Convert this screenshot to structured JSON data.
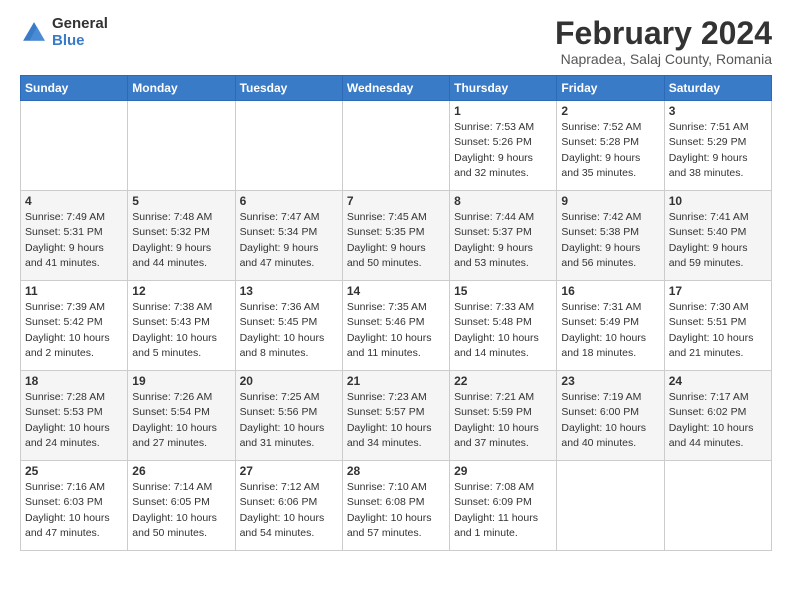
{
  "logo": {
    "general": "General",
    "blue": "Blue"
  },
  "header": {
    "title": "February 2024",
    "subtitle": "Napradea, Salaj County, Romania"
  },
  "weekdays": [
    "Sunday",
    "Monday",
    "Tuesday",
    "Wednesday",
    "Thursday",
    "Friday",
    "Saturday"
  ],
  "weeks": [
    [
      {
        "day": "",
        "info": ""
      },
      {
        "day": "",
        "info": ""
      },
      {
        "day": "",
        "info": ""
      },
      {
        "day": "",
        "info": ""
      },
      {
        "day": "1",
        "info": "Sunrise: 7:53 AM\nSunset: 5:26 PM\nDaylight: 9 hours\nand 32 minutes."
      },
      {
        "day": "2",
        "info": "Sunrise: 7:52 AM\nSunset: 5:28 PM\nDaylight: 9 hours\nand 35 minutes."
      },
      {
        "day": "3",
        "info": "Sunrise: 7:51 AM\nSunset: 5:29 PM\nDaylight: 9 hours\nand 38 minutes."
      }
    ],
    [
      {
        "day": "4",
        "info": "Sunrise: 7:49 AM\nSunset: 5:31 PM\nDaylight: 9 hours\nand 41 minutes."
      },
      {
        "day": "5",
        "info": "Sunrise: 7:48 AM\nSunset: 5:32 PM\nDaylight: 9 hours\nand 44 minutes."
      },
      {
        "day": "6",
        "info": "Sunrise: 7:47 AM\nSunset: 5:34 PM\nDaylight: 9 hours\nand 47 minutes."
      },
      {
        "day": "7",
        "info": "Sunrise: 7:45 AM\nSunset: 5:35 PM\nDaylight: 9 hours\nand 50 minutes."
      },
      {
        "day": "8",
        "info": "Sunrise: 7:44 AM\nSunset: 5:37 PM\nDaylight: 9 hours\nand 53 minutes."
      },
      {
        "day": "9",
        "info": "Sunrise: 7:42 AM\nSunset: 5:38 PM\nDaylight: 9 hours\nand 56 minutes."
      },
      {
        "day": "10",
        "info": "Sunrise: 7:41 AM\nSunset: 5:40 PM\nDaylight: 9 hours\nand 59 minutes."
      }
    ],
    [
      {
        "day": "11",
        "info": "Sunrise: 7:39 AM\nSunset: 5:42 PM\nDaylight: 10 hours\nand 2 minutes."
      },
      {
        "day": "12",
        "info": "Sunrise: 7:38 AM\nSunset: 5:43 PM\nDaylight: 10 hours\nand 5 minutes."
      },
      {
        "day": "13",
        "info": "Sunrise: 7:36 AM\nSunset: 5:45 PM\nDaylight: 10 hours\nand 8 minutes."
      },
      {
        "day": "14",
        "info": "Sunrise: 7:35 AM\nSunset: 5:46 PM\nDaylight: 10 hours\nand 11 minutes."
      },
      {
        "day": "15",
        "info": "Sunrise: 7:33 AM\nSunset: 5:48 PM\nDaylight: 10 hours\nand 14 minutes."
      },
      {
        "day": "16",
        "info": "Sunrise: 7:31 AM\nSunset: 5:49 PM\nDaylight: 10 hours\nand 18 minutes."
      },
      {
        "day": "17",
        "info": "Sunrise: 7:30 AM\nSunset: 5:51 PM\nDaylight: 10 hours\nand 21 minutes."
      }
    ],
    [
      {
        "day": "18",
        "info": "Sunrise: 7:28 AM\nSunset: 5:53 PM\nDaylight: 10 hours\nand 24 minutes."
      },
      {
        "day": "19",
        "info": "Sunrise: 7:26 AM\nSunset: 5:54 PM\nDaylight: 10 hours\nand 27 minutes."
      },
      {
        "day": "20",
        "info": "Sunrise: 7:25 AM\nSunset: 5:56 PM\nDaylight: 10 hours\nand 31 minutes."
      },
      {
        "day": "21",
        "info": "Sunrise: 7:23 AM\nSunset: 5:57 PM\nDaylight: 10 hours\nand 34 minutes."
      },
      {
        "day": "22",
        "info": "Sunrise: 7:21 AM\nSunset: 5:59 PM\nDaylight: 10 hours\nand 37 minutes."
      },
      {
        "day": "23",
        "info": "Sunrise: 7:19 AM\nSunset: 6:00 PM\nDaylight: 10 hours\nand 40 minutes."
      },
      {
        "day": "24",
        "info": "Sunrise: 7:17 AM\nSunset: 6:02 PM\nDaylight: 10 hours\nand 44 minutes."
      }
    ],
    [
      {
        "day": "25",
        "info": "Sunrise: 7:16 AM\nSunset: 6:03 PM\nDaylight: 10 hours\nand 47 minutes."
      },
      {
        "day": "26",
        "info": "Sunrise: 7:14 AM\nSunset: 6:05 PM\nDaylight: 10 hours\nand 50 minutes."
      },
      {
        "day": "27",
        "info": "Sunrise: 7:12 AM\nSunset: 6:06 PM\nDaylight: 10 hours\nand 54 minutes."
      },
      {
        "day": "28",
        "info": "Sunrise: 7:10 AM\nSunset: 6:08 PM\nDaylight: 10 hours\nand 57 minutes."
      },
      {
        "day": "29",
        "info": "Sunrise: 7:08 AM\nSunset: 6:09 PM\nDaylight: 11 hours\nand 1 minute."
      },
      {
        "day": "",
        "info": ""
      },
      {
        "day": "",
        "info": ""
      }
    ]
  ]
}
